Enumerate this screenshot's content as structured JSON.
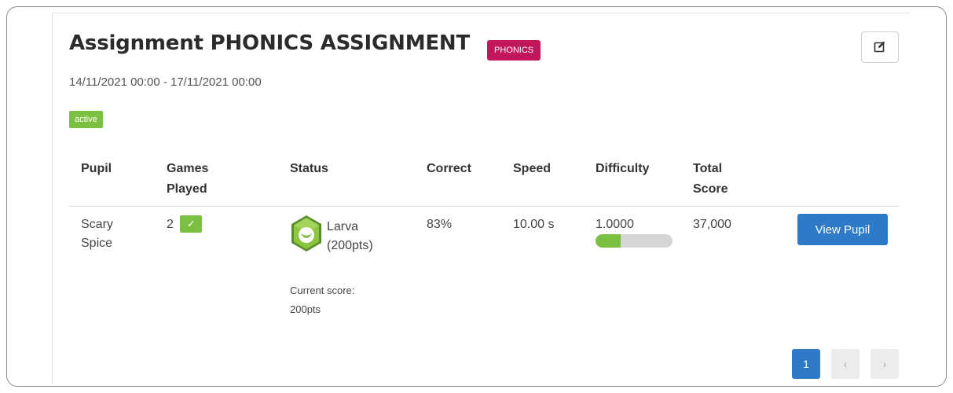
{
  "assignment": {
    "title": "Assignment PHONICS ASSIGNMENT",
    "tag": "PHONICS",
    "dates": "14/11/2021 00:00 - 17/11/2021 00:00",
    "status_badge": "active",
    "edit_icon": "edit-icon"
  },
  "table": {
    "headers": {
      "pupil": "Pupil",
      "games_played_1": "Games",
      "games_played_2": "Played",
      "status": "Status",
      "correct": "Correct",
      "speed": "Speed",
      "difficulty": "Difficulty",
      "total_score_1": "Total",
      "total_score_2": "Score"
    },
    "rows": [
      {
        "pupil_1": "Scary",
        "pupil_2": "Spice",
        "games_played": "2",
        "games_check": "✓",
        "level_name": "Larva",
        "level_points": "(200pts)",
        "current_score_label": "Current score:",
        "current_score_value": "200pts",
        "correct": "83%",
        "speed": "10.00 s",
        "difficulty": "1.0000",
        "difficulty_progress": 0.33,
        "total_score": "37,000",
        "action": "View Pupil"
      }
    ]
  },
  "pagination": {
    "current": "1",
    "prev": "‹",
    "next": "›"
  },
  "colors": {
    "accent_blue": "#2f7ac6",
    "tag_magenta": "#c2185b",
    "success_green": "#7bc043"
  }
}
